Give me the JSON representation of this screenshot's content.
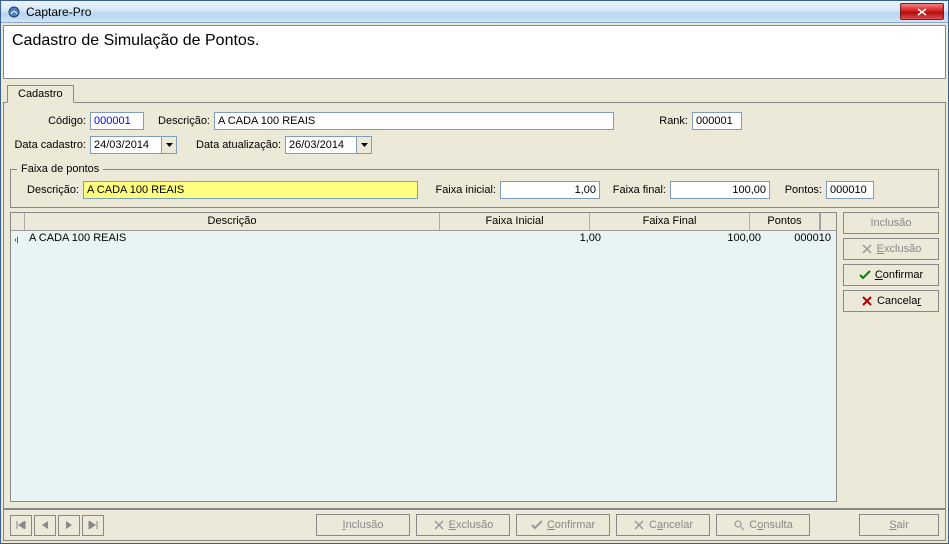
{
  "window": {
    "title": "Captare-Pro"
  },
  "header": {
    "title": "Cadastro de Simulação de Pontos."
  },
  "tab": {
    "label": "Cadastro"
  },
  "form": {
    "codigo_label": "Código:",
    "codigo_value": "000001",
    "descricao_label": "Descrição:",
    "descricao_value": "A CADA 100 REAIS",
    "rank_label": "Rank:",
    "rank_value": "000001",
    "data_cadastro_label": "Data cadastro:",
    "data_cadastro_value": "24/03/2014",
    "data_atualizacao_label": "Data atualização:",
    "data_atualizacao_value": "26/03/2014"
  },
  "faixa": {
    "legend": "Faixa de pontos",
    "descricao_label": "Descrição:",
    "descricao_value": "A CADA 100 REAIS",
    "faixa_inicial_label": "Faixa inicial:",
    "faixa_inicial_value": "1,00",
    "faixa_final_label": "Faixa final:",
    "faixa_final_value": "100,00",
    "pontos_label": "Pontos:",
    "pontos_value": "000010"
  },
  "grid": {
    "headers": {
      "descricao": "Descrição",
      "faixa_inicial": "Faixa Inicial",
      "faixa_final": "Faixa Final",
      "pontos": "Pontos"
    },
    "rows": [
      {
        "descricao": "A CADA 100 REAIS",
        "faixa_inicial": "1,00",
        "faixa_final": "100,00",
        "pontos": "000010"
      }
    ]
  },
  "side_buttons": {
    "inclusao": "Inclusão",
    "exclusao": "Exclusão",
    "confirmar": "Confirmar",
    "cancelar": "Cancelar"
  },
  "bottom": {
    "inclusao": "Inclusão",
    "exclusao": "Exclusão",
    "confirmar": "Confirmar",
    "cancelar": "Cancelar",
    "consulta": "Consulta",
    "sair": "Sair"
  }
}
